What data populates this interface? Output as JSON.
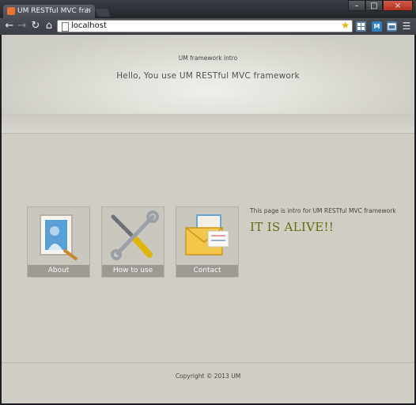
{
  "browser": {
    "tab_title": "UM RESTful MVC framework",
    "tab_close": "×",
    "url": "localhost",
    "window_buttons": {
      "minimize": "–",
      "maximize": "□",
      "close": "×"
    }
  },
  "toolbar_icons": [
    "back-arrow-icon",
    "forward-arrow-icon",
    "reload-icon",
    "home-icon",
    "bookmark-star-icon",
    "menu-icon"
  ],
  "extensions": [
    {
      "name": "extension-grid-icon",
      "label": "",
      "color": "#5d7fa8"
    },
    {
      "name": "extension-m-icon",
      "label": "M",
      "color": "#2f7fc1"
    },
    {
      "name": "extension-window-icon",
      "label": "",
      "color": "#4a7aa0"
    }
  ],
  "header": {
    "small_title": "UM framework intro",
    "hello": "Hello, You use UM RESTful MVC framework"
  },
  "tiles": [
    {
      "label": "About",
      "icon": "picture-frame-icon"
    },
    {
      "label": "How to use",
      "icon": "wrench-screwdriver-icon"
    },
    {
      "label": "Contact",
      "icon": "mail-envelope-icon"
    }
  ],
  "intro": {
    "description": "This page is intro for UM RESTful MVC framework",
    "status": "IT IS ALIVE!!"
  },
  "footer": {
    "copyright": "Copyright © 2013 UM"
  }
}
